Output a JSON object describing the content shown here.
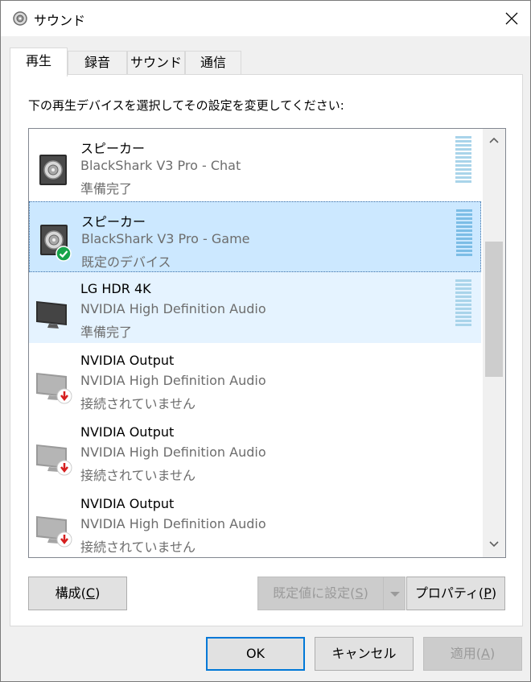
{
  "window": {
    "title": "サウンド",
    "icon": "speaker-icon"
  },
  "tabs": [
    {
      "label": "再生",
      "active": true
    },
    {
      "label": "録音",
      "active": false
    },
    {
      "label": "サウンド",
      "active": false
    },
    {
      "label": "通信",
      "active": false
    }
  ],
  "instruction": "下の再生デバイスを選択してその設定を変更してください:",
  "devices": [
    {
      "name": "スピーカー",
      "description": "BlackShark V3 Pro - Chat",
      "status": "準備完了",
      "icon": "speaker-device-icon",
      "state": "normal"
    },
    {
      "name": "スピーカー",
      "description": "BlackShark V3 Pro - Game",
      "status": "既定のデバイス",
      "icon": "speaker-device-icon",
      "badge": "default-check-icon",
      "state": "selected"
    },
    {
      "name": "LG HDR 4K",
      "description": "NVIDIA High Definition Audio",
      "status": "準備完了",
      "icon": "monitor-device-icon",
      "state": "hover"
    },
    {
      "name": "NVIDIA Output",
      "description": "NVIDIA High Definition Audio",
      "status": "接続されていません",
      "icon": "monitor-device-icon",
      "badge": "disconnected-arrow-icon",
      "state": "normal"
    },
    {
      "name": "NVIDIA Output",
      "description": "NVIDIA High Definition Audio",
      "status": "接続されていません",
      "icon": "monitor-device-icon",
      "badge": "disconnected-arrow-icon",
      "state": "normal"
    },
    {
      "name": "NVIDIA Output",
      "description": "NVIDIA High Definition Audio",
      "status": "接続されていません",
      "icon": "monitor-device-icon",
      "badge": "disconnected-arrow-icon",
      "state": "normal"
    }
  ],
  "buttons": {
    "configure": {
      "label": "構成(",
      "key": "C",
      "suffix": ")"
    },
    "set_default": {
      "label": "既定値に設定(",
      "key": "S",
      "suffix": ")",
      "enabled": false
    },
    "properties": {
      "label": "プロパティ(",
      "key": "P",
      "suffix": ")"
    },
    "ok": "OK",
    "cancel": "キャンセル",
    "apply": {
      "label": "適用(",
      "key": "A",
      "suffix": ")",
      "enabled": false
    }
  },
  "colors": {
    "selected_bg": "#cce8ff",
    "hover_bg": "#e5f3ff",
    "accent": "#0078d7",
    "default_check": "#16a34a",
    "disconnected": "#d61f1f"
  }
}
